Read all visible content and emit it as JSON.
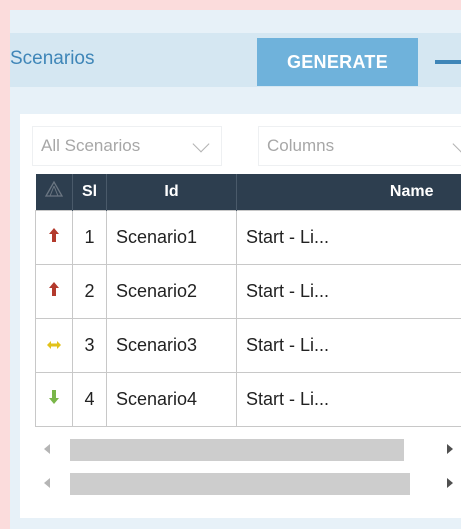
{
  "panel": {
    "title": "Scenarios",
    "generate_label": "GENERATE"
  },
  "filters": {
    "scenarios_dropdown": "All Scenarios",
    "columns_dropdown": "Columns"
  },
  "grid": {
    "headers": [
      "",
      "Sl",
      "Id",
      "Name"
    ],
    "rows": [
      {
        "trend": "up",
        "sl": "1",
        "id": "Scenario1",
        "name": "Start - Li..."
      },
      {
        "trend": "up",
        "sl": "2",
        "id": "Scenario2",
        "name": "Start - Li..."
      },
      {
        "trend": "flat",
        "sl": "3",
        "id": "Scenario3",
        "name": "Start - Li..."
      },
      {
        "trend": "down",
        "sl": "4",
        "id": "Scenario4",
        "name": "Start - Li..."
      }
    ]
  },
  "colors": {
    "header_bg": "#2d3e4f",
    "generate_bg": "#6fb2db",
    "accent": "#3f86b8",
    "trend_up": "#b33a2c",
    "trend_flat": "#e2c21b",
    "trend_down": "#7ab649"
  }
}
